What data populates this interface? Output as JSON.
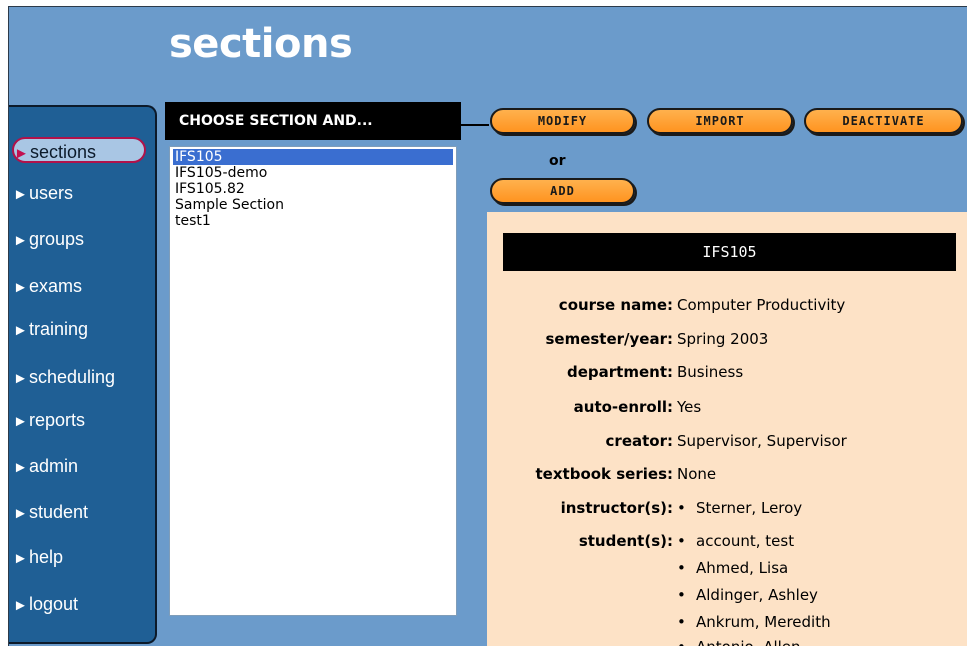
{
  "header": {
    "title": "sections"
  },
  "sidebar": {
    "items": [
      {
        "label": "sections",
        "active": true
      },
      {
        "label": "users"
      },
      {
        "label": "groups"
      },
      {
        "label": "exams"
      },
      {
        "label": "training"
      },
      {
        "label": "scheduling"
      },
      {
        "label": "reports"
      },
      {
        "label": "admin"
      },
      {
        "label": "student"
      },
      {
        "label": "help"
      },
      {
        "label": "logout"
      }
    ],
    "arrow": "►"
  },
  "chooser": {
    "title": "CHOOSE SECTION AND...",
    "sections": [
      "IFS105",
      "IFS105-demo",
      "IFS105.82",
      "Sample Section",
      "test1"
    ],
    "selected": "IFS105"
  },
  "actions": {
    "modify": "MODIFY",
    "import": "IMPORT",
    "deactivate": "DEACTIVATE",
    "or": "or",
    "add": "ADD"
  },
  "detail": {
    "title": "IFS105",
    "bullet": "•",
    "fields": {
      "course_name": {
        "label": "course name:",
        "value": "Computer Productivity"
      },
      "semester_year": {
        "label": "semester/year:",
        "value": "Spring 2003"
      },
      "department": {
        "label": "department:",
        "value": "Business"
      },
      "auto_enroll": {
        "label": "auto-enroll:",
        "value": "Yes"
      },
      "creator": {
        "label": "creator:",
        "value": "Supervisor, Supervisor"
      },
      "textbook_series": {
        "label": "textbook series:",
        "value": "None"
      }
    },
    "instructors": {
      "label": "instructor(s):",
      "names": [
        "Sterner, Leroy"
      ]
    },
    "students": {
      "label": "student(s):",
      "names": [
        "account, test",
        "Ahmed, Lisa",
        "Aldinger, Ashley",
        "Ankrum, Meredith",
        "Antonio, Allen"
      ]
    }
  },
  "colors": {
    "background": "#6b9bcb",
    "sidebar": "#1f5f95",
    "button": "#ff9f2e",
    "detail_panel": "#fde2c6",
    "selection": "#3a6ed0"
  }
}
